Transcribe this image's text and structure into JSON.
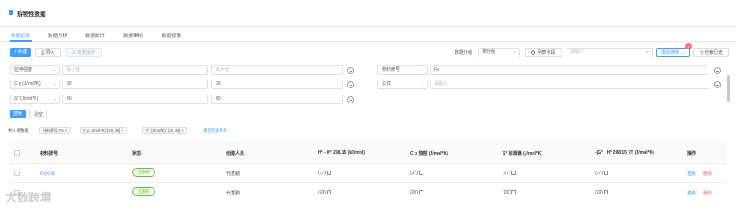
{
  "page_title": "热物性数据",
  "tabs": [
    "数据记录",
    "数据分析",
    "数据统计",
    "数据审核",
    "数据权限"
  ],
  "toolbar": {
    "new_label": "+ 新建",
    "import_label": "导入",
    "batch_label": "批量操作",
    "group_label": "数据分组",
    "group_value": "未分组",
    "columns_label": "列表字段",
    "search_placeholder": "请输入",
    "advanced_label": "高级搜索",
    "advanced_badge": "3",
    "history_label": "检索历史"
  },
  "filters": {
    "left": [
      {
        "field": "拉伸强度",
        "min": "最小值",
        "max": "最大值",
        "min_placeholder": true
      },
      {
        "field": "C p (J/mol*K)",
        "min": "20",
        "max": "30",
        "min_placeholder": false
      },
      {
        "field": "S° (J/mol*K)",
        "min": "40",
        "max": "60",
        "min_placeholder": false
      }
    ],
    "right": [
      {
        "field": "材料牌号",
        "value": "Fe",
        "placeholder": false
      },
      {
        "field": "公式",
        "value": "请输入",
        "placeholder": true
      }
    ],
    "search_label": "搜索",
    "clear_label": "清空"
  },
  "summary": {
    "count_text": "共 2 条数据:",
    "tags": [
      "材料牌号: Fe",
      "C p (J/mol*K): [20, 30]",
      "S° (J/mol*K): [40, 60]"
    ],
    "clear_link": "清空检索条件"
  },
  "table": {
    "headers": [
      "材料牌号",
      "状态",
      "创建人员",
      "H° - H° 298.15 (kJ/mol)",
      "C p 热容 (J/mol*K)",
      "S° 标准熵 (J/mol*K)",
      "-(G° - H° 298.15 )/T (J/mol*K)",
      "操作"
    ],
    "rows": [
      {
        "name": "Fe(s)相",
        "status": "已发布",
        "creator": "代慧勤",
        "h": "(17)",
        "cp": "(17)",
        "s": "(17)",
        "g": "(17)",
        "op_view": "查看",
        "op_delete": "删除"
      },
      {
        "name": "",
        "status": "已发布",
        "creator": "代慧勤",
        "h": "(20)",
        "cp": "(20)",
        "s": "(20)",
        "g": "(20)",
        "op_view": "查看",
        "op_delete": "删除"
      }
    ]
  },
  "watermark": "大数跨境",
  "colors": {
    "primary": "#409eff",
    "success": "#67c23a",
    "danger": "#f56c6c"
  }
}
